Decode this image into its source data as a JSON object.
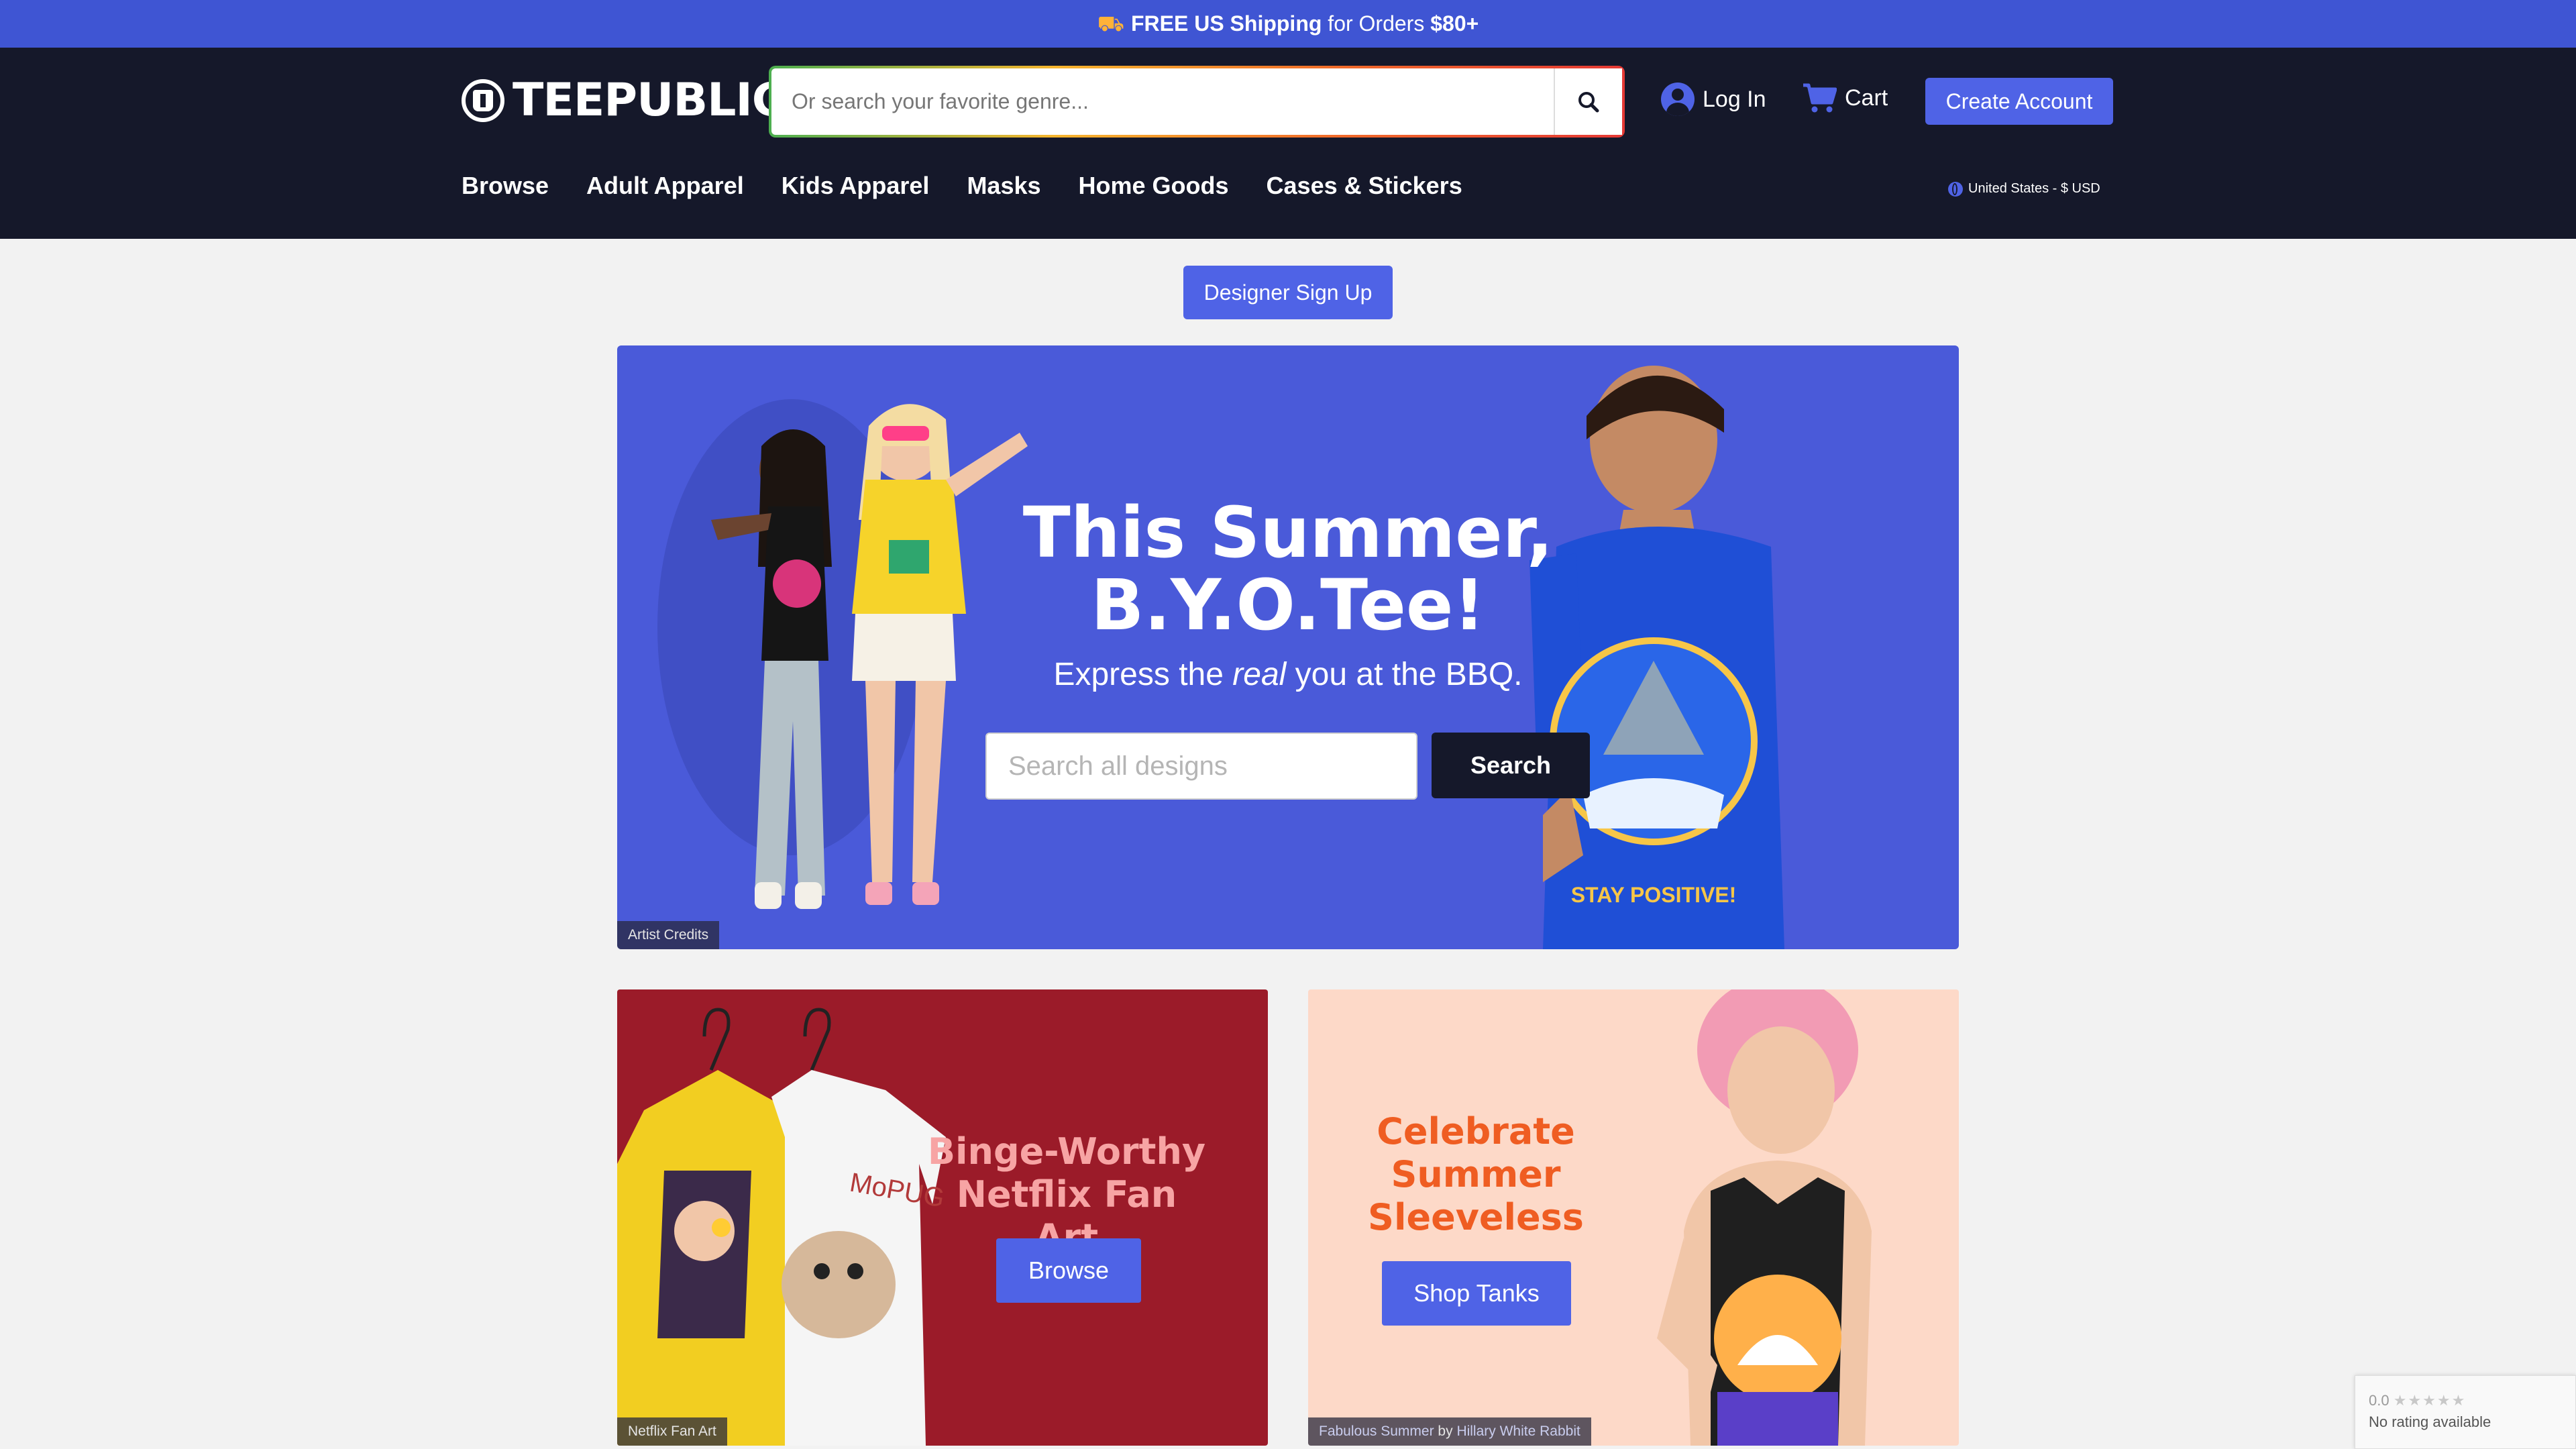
{
  "promo": {
    "free_label": "FREE US Shipping",
    "middle": " for Orders ",
    "amount": "$80+"
  },
  "header": {
    "logo_text": "TEEPUBLIC",
    "search_placeholder": "Or search your favorite genre...",
    "login_label": "Log In",
    "cart_label": "Cart",
    "create_account_label": "Create Account",
    "nav": [
      "Browse",
      "Adult Apparel",
      "Kids Apparel",
      "Masks",
      "Home Goods",
      "Cases & Stickers"
    ],
    "locale_label": "United States - $ USD"
  },
  "designer_signup_label": "Designer Sign Up",
  "hero": {
    "title_line1": "This Summer,",
    "title_line2": "B.Y.O.Tee!",
    "subtitle_pre": "Express the ",
    "subtitle_em": "real",
    "subtitle_post": " you at the BBQ.",
    "search_placeholder": "Search all designs",
    "search_button": "Search",
    "credit": "Artist Credits",
    "shirt_text": "STAY POSITIVE!"
  },
  "cards": {
    "netflix": {
      "title_line1": "Binge-Worthy",
      "title_line2": "Netflix Fan Art",
      "button": "Browse",
      "credit": "Netflix Fan Art",
      "shirt_text": "MoPUG"
    },
    "summer": {
      "title_line1": "Celebrate",
      "title_line2": "Summer",
      "title_line3": "Sleeveless",
      "button": "Shop Tanks",
      "credit_title": "Fabulous Summer",
      "credit_by": " by ",
      "credit_artist": "Hillary White Rabbit"
    }
  },
  "recaptcha": {
    "score": "0.0",
    "stars": "★★★★★",
    "label": "No rating available"
  },
  "colors": {
    "promo": "#3f55d3",
    "header": "#15182a",
    "accent": "#4f63e6",
    "hero": "#4a5ad9",
    "netflix_card": "#9b1b29",
    "summer_card": "#fdd9c8"
  }
}
